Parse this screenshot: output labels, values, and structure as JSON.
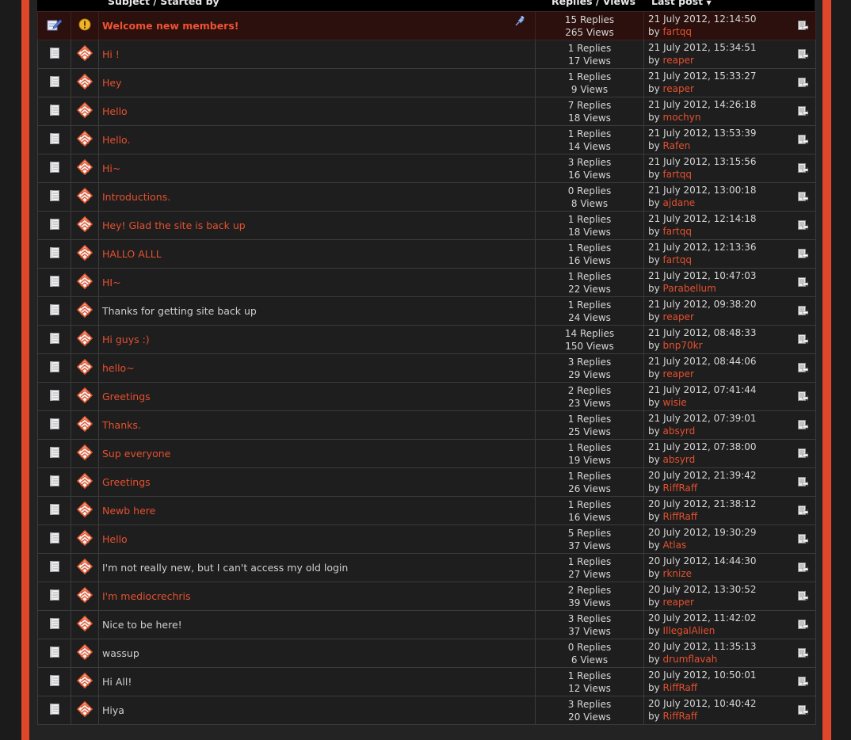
{
  "header": {
    "subject": "Subject / Started by",
    "replies": "Replies / Views",
    "last_post": "Last post"
  },
  "labels": {
    "replies_suffix": "Replies",
    "views_suffix": "Views",
    "by": "by"
  },
  "colors": {
    "accent": "#e0462a",
    "link": "#e5502f",
    "sticky_bg": "#2b100d",
    "row_bg": "#1e1e1e"
  },
  "topics": [
    {
      "subject": "Welcome new members!",
      "sticky": true,
      "plain": false,
      "replies": "15",
      "views": "265",
      "date": "21 July 2012, 12:14:50",
      "user": "fartqq"
    },
    {
      "subject": "Hi !",
      "sticky": false,
      "plain": false,
      "replies": "1",
      "views": "17",
      "date": "21 July 2012, 15:34:51",
      "user": "reaper"
    },
    {
      "subject": "Hey",
      "sticky": false,
      "plain": false,
      "replies": "1",
      "views": "9",
      "date": "21 July 2012, 15:33:27",
      "user": "reaper"
    },
    {
      "subject": "Hello",
      "sticky": false,
      "plain": false,
      "replies": "7",
      "views": "18",
      "date": "21 July 2012, 14:26:18",
      "user": "mochyn"
    },
    {
      "subject": "Hello.",
      "sticky": false,
      "plain": false,
      "replies": "1",
      "views": "14",
      "date": "21 July 2012, 13:53:39",
      "user": "Rafen"
    },
    {
      "subject": "Hi~",
      "sticky": false,
      "plain": false,
      "replies": "3",
      "views": "16",
      "date": "21 July 2012, 13:15:56",
      "user": "fartqq"
    },
    {
      "subject": "Introductions.",
      "sticky": false,
      "plain": false,
      "replies": "0",
      "views": "8",
      "date": "21 July 2012, 13:00:18",
      "user": "ajdane"
    },
    {
      "subject": "Hey! Glad the site is back up",
      "sticky": false,
      "plain": false,
      "replies": "1",
      "views": "18",
      "date": "21 July 2012, 12:14:18",
      "user": "fartqq"
    },
    {
      "subject": "HALLO ALLL",
      "sticky": false,
      "plain": false,
      "replies": "1",
      "views": "16",
      "date": "21 July 2012, 12:13:36",
      "user": "fartqq"
    },
    {
      "subject": "HI~",
      "sticky": false,
      "plain": false,
      "replies": "1",
      "views": "22",
      "date": "21 July 2012, 10:47:03",
      "user": "Parabellum"
    },
    {
      "subject": "Thanks for getting site back up",
      "sticky": false,
      "plain": true,
      "replies": "1",
      "views": "24",
      "date": "21 July 2012, 09:38:20",
      "user": "reaper"
    },
    {
      "subject": "Hi guys :)",
      "sticky": false,
      "plain": false,
      "replies": "14",
      "views": "150",
      "date": "21 July 2012, 08:48:33",
      "user": "bnp70kr"
    },
    {
      "subject": "hello~",
      "sticky": false,
      "plain": false,
      "replies": "3",
      "views": "29",
      "date": "21 July 2012, 08:44:06",
      "user": "reaper"
    },
    {
      "subject": "Greetings",
      "sticky": false,
      "plain": false,
      "replies": "2",
      "views": "23",
      "date": "21 July 2012, 07:41:44",
      "user": "wisie"
    },
    {
      "subject": "Thanks.",
      "sticky": false,
      "plain": false,
      "replies": "1",
      "views": "25",
      "date": "21 July 2012, 07:39:01",
      "user": "absyrd"
    },
    {
      "subject": "Sup everyone",
      "sticky": false,
      "plain": false,
      "replies": "1",
      "views": "19",
      "date": "21 July 2012, 07:38:00",
      "user": "absyrd"
    },
    {
      "subject": "Greetings",
      "sticky": false,
      "plain": false,
      "replies": "1",
      "views": "26",
      "date": "20 July 2012, 21:39:42",
      "user": "RiffRaff"
    },
    {
      "subject": "Newb here",
      "sticky": false,
      "plain": false,
      "replies": "1",
      "views": "16",
      "date": "20 July 2012, 21:38:12",
      "user": "RiffRaff"
    },
    {
      "subject": "Hello",
      "sticky": false,
      "plain": false,
      "replies": "5",
      "views": "37",
      "date": "20 July 2012, 19:30:29",
      "user": "Atlas"
    },
    {
      "subject": "I'm not really new, but I can't access my old login",
      "sticky": false,
      "plain": true,
      "replies": "1",
      "views": "27",
      "date": "20 July 2012, 14:44:30",
      "user": "rknize"
    },
    {
      "subject": "I'm mediocrechris",
      "sticky": false,
      "plain": false,
      "replies": "2",
      "views": "39",
      "date": "20 July 2012, 13:30:52",
      "user": "reaper"
    },
    {
      "subject": "Nice to be here!",
      "sticky": false,
      "plain": true,
      "replies": "3",
      "views": "37",
      "date": "20 July 2012, 11:42:02",
      "user": "IllegalAlien"
    },
    {
      "subject": "wassup",
      "sticky": false,
      "plain": true,
      "replies": "0",
      "views": "6",
      "date": "20 July 2012, 11:35:13",
      "user": "drumflavah"
    },
    {
      "subject": "Hi All!",
      "sticky": false,
      "plain": true,
      "replies": "1",
      "views": "12",
      "date": "20 July 2012, 10:50:01",
      "user": "RiffRaff"
    },
    {
      "subject": "Hiya",
      "sticky": false,
      "plain": true,
      "replies": "3",
      "views": "20",
      "date": "20 July 2012, 10:40:42",
      "user": "RiffRaff"
    }
  ]
}
